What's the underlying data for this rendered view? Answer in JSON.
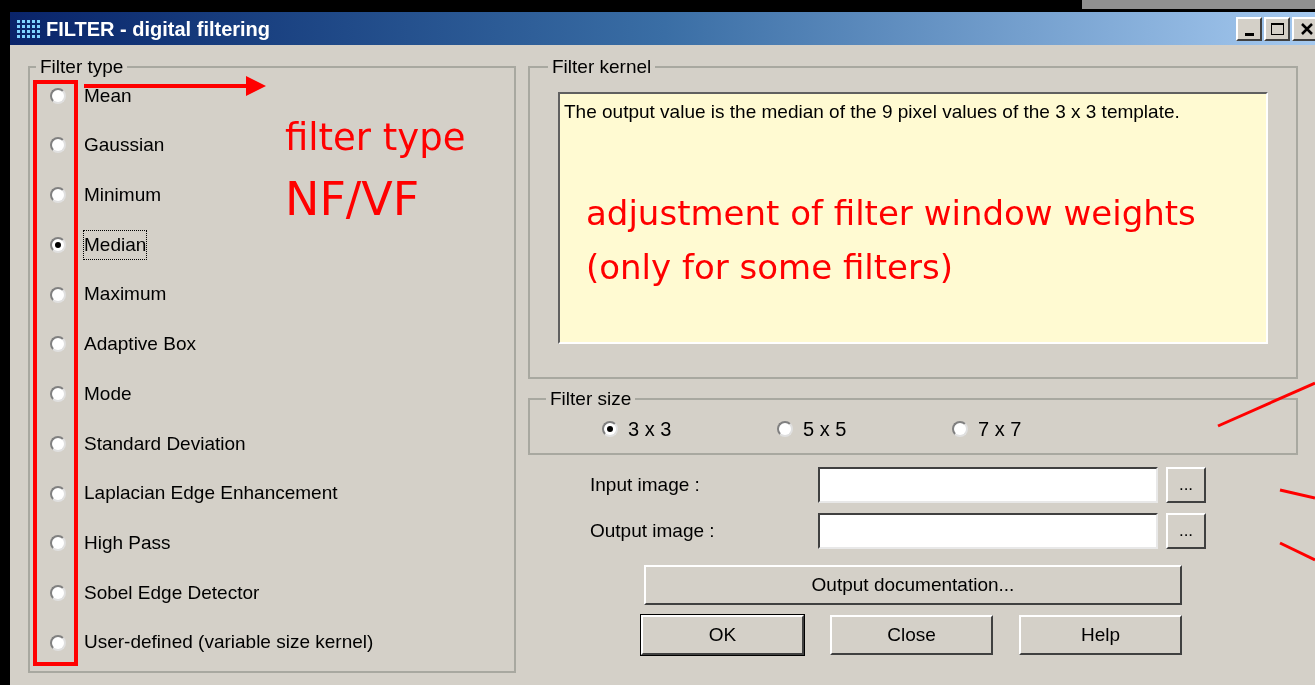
{
  "window": {
    "title": "FILTER - digital filtering"
  },
  "filter_type": {
    "label": "Filter type",
    "options": [
      {
        "label": "Mean",
        "selected": false
      },
      {
        "label": "Gaussian",
        "selected": false
      },
      {
        "label": "Minimum",
        "selected": false
      },
      {
        "label": "Median",
        "selected": true
      },
      {
        "label": "Maximum",
        "selected": false
      },
      {
        "label": "Adaptive Box",
        "selected": false
      },
      {
        "label": "Mode",
        "selected": false
      },
      {
        "label": "Standard Deviation",
        "selected": false
      },
      {
        "label": "Laplacian Edge Enhancement",
        "selected": false
      },
      {
        "label": "High Pass",
        "selected": false
      },
      {
        "label": "Sobel Edge Detector",
        "selected": false
      },
      {
        "label": "User-defined (variable size kernel)",
        "selected": false
      }
    ]
  },
  "filter_kernel": {
    "label": "Filter kernel",
    "description": "The output value is the median of the 9 pixel values of the 3 x 3 template."
  },
  "filter_size": {
    "label": "Filter size",
    "options": [
      {
        "label": "3 x 3",
        "selected": true
      },
      {
        "label": "5 x 5",
        "selected": false
      },
      {
        "label": "7 x 7",
        "selected": false
      }
    ]
  },
  "files": [
    {
      "label": "Input image :",
      "browse": "..."
    },
    {
      "label": "Output image :",
      "browse": "..."
    }
  ],
  "buttons": {
    "documentation": "Output documentation...",
    "actions": [
      "OK",
      "Close",
      "Help"
    ]
  },
  "annotations": [
    "filter type",
    "NF/VF",
    "adjustment of filter window weights",
    "(only for some filters)"
  ]
}
